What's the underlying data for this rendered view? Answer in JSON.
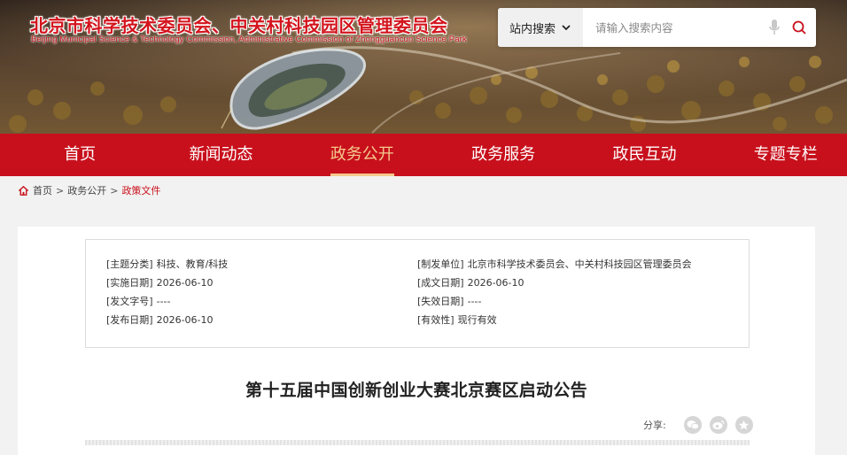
{
  "header": {
    "title": "北京市科学技术委员会、中关村科技园区管理委员会",
    "subtitle": "Beijing Municipal Science & Technology Commission, Administrative Commission of Zhongguancun Science Park"
  },
  "search": {
    "scope_label": "站内搜索",
    "placeholder": "请输入搜索内容",
    "mic_icon": "microphone-icon",
    "search_icon": "search-icon"
  },
  "nav": {
    "items": [
      {
        "label": "首页"
      },
      {
        "label": "新闻动态"
      },
      {
        "label": "政务公开",
        "active": true
      },
      {
        "label": "政务服务"
      },
      {
        "label": "政民互动"
      },
      {
        "label": "专题专栏"
      }
    ]
  },
  "breadcrumb": {
    "items": [
      "首页",
      "政务公开",
      "政策文件"
    ],
    "separator": ">"
  },
  "meta": {
    "left": [
      {
        "key": "[主题分类]",
        "value": "科技、教育/科技"
      },
      {
        "key": "[实施日期]",
        "value": "2026-06-10"
      },
      {
        "key": "[发文字号]",
        "value": "----"
      },
      {
        "key": "[发布日期]",
        "value": "2026-06-10"
      }
    ],
    "right": [
      {
        "key": "[制发单位]",
        "value": "北京市科学技术委员会、中关村科技园区管理委员会"
      },
      {
        "key": "[成文日期]",
        "value": "2026-06-10"
      },
      {
        "key": "[失效日期]",
        "value": "----"
      },
      {
        "key": "[有效性]",
        "value": "现行有效"
      }
    ]
  },
  "article": {
    "title": "第十五届中国创新创业大赛北京赛区启动公告"
  },
  "share": {
    "label": "分享:",
    "buttons": [
      "wechat-icon",
      "weibo-icon",
      "star-icon"
    ]
  },
  "colors": {
    "brand_red": "#c8101c",
    "nav_active": "#f5c98e"
  }
}
